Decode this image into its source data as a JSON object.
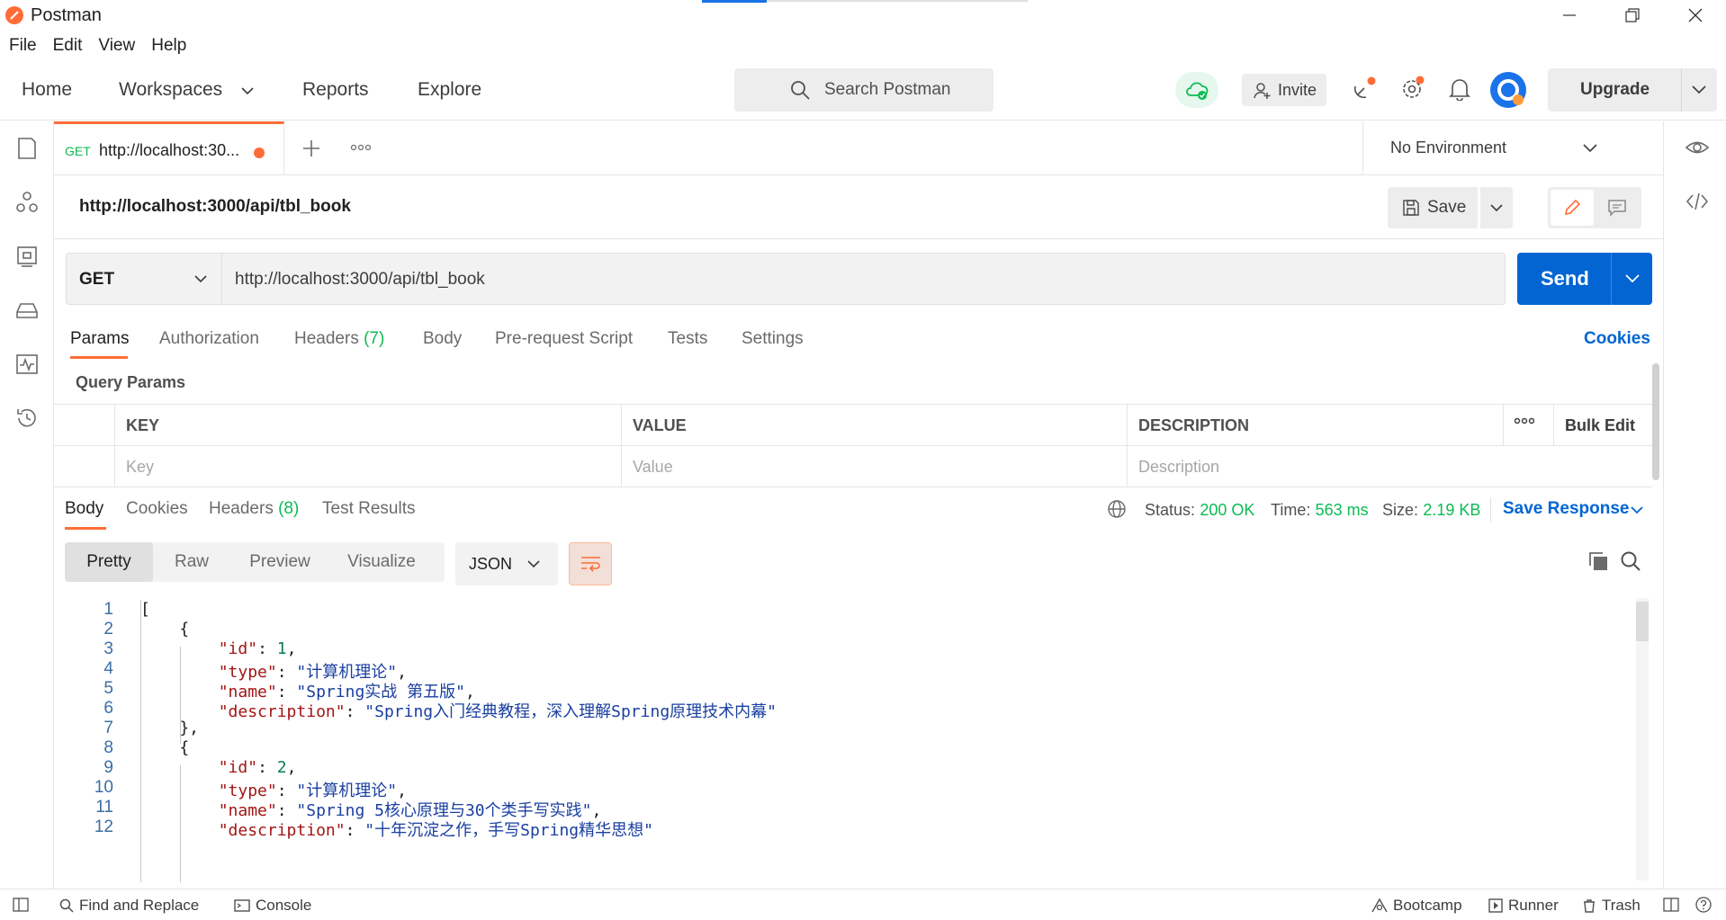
{
  "window": {
    "title": "Postman"
  },
  "menu": [
    "File",
    "Edit",
    "View",
    "Help"
  ],
  "header": {
    "nav": [
      "Home",
      "Workspaces",
      "Reports",
      "Explore"
    ],
    "search_placeholder": "Search Postman",
    "invite_label": "Invite",
    "upgrade_label": "Upgrade"
  },
  "tab": {
    "method": "GET",
    "title": "http://localhost:30...",
    "unsaved": true
  },
  "environment": {
    "selected": "No Environment"
  },
  "request": {
    "name": "http://localhost:3000/api/tbl_book",
    "save_label": "Save",
    "method": "GET",
    "url": "http://localhost:3000/api/tbl_book",
    "send_label": "Send",
    "tabs": [
      {
        "label": "Params"
      },
      {
        "label": "Authorization"
      },
      {
        "label": "Headers",
        "count": "(7)"
      },
      {
        "label": "Body"
      },
      {
        "label": "Pre-request Script"
      },
      {
        "label": "Tests"
      },
      {
        "label": "Settings"
      }
    ],
    "cookies_label": "Cookies",
    "query_params_title": "Query Params",
    "params_table": {
      "headers": [
        "KEY",
        "VALUE",
        "DESCRIPTION"
      ],
      "bulk_edit_label": "Bulk Edit",
      "placeholders": [
        "Key",
        "Value",
        "Description"
      ]
    }
  },
  "response": {
    "tabs": [
      {
        "label": "Body"
      },
      {
        "label": "Cookies"
      },
      {
        "label": "Headers",
        "count": "(8)"
      },
      {
        "label": "Test Results"
      }
    ],
    "status_key": "Status:",
    "status": "200 OK",
    "time_key": "Time:",
    "time": "563 ms",
    "size_key": "Size:",
    "size": "2.19 KB",
    "save_response_label": "Save Response",
    "views": [
      "Pretty",
      "Raw",
      "Preview",
      "Visualize"
    ],
    "format": "JSON",
    "code_lines": [
      {
        "n": "1",
        "text": "["
      },
      {
        "n": "2",
        "text": "    {"
      },
      {
        "n": "3",
        "key": "\"id\"",
        "num": "1"
      },
      {
        "n": "4",
        "key": "\"type\"",
        "str": "\"计算机理论\""
      },
      {
        "n": "5",
        "key": "\"name\"",
        "str": "\"Spring实战 第五版\""
      },
      {
        "n": "6",
        "key": "\"description\"",
        "str": "\"Spring入门经典教程，深入理解Spring原理技术内幕\"",
        "last": true
      },
      {
        "n": "7",
        "text": "    },"
      },
      {
        "n": "8",
        "text": "    {"
      },
      {
        "n": "9",
        "key": "\"id\"",
        "num": "2"
      },
      {
        "n": "10",
        "key": "\"type\"",
        "str": "\"计算机理论\""
      },
      {
        "n": "11",
        "key": "\"name\"",
        "str": "\"Spring 5核心原理与30个类手写实践\""
      },
      {
        "n": "12",
        "key": "\"description\"",
        "str": "\"十年沉淀之作，手写Spring精华思想\"",
        "last": true
      }
    ]
  },
  "statusbar": {
    "left": [
      "Find and Replace",
      "Console"
    ],
    "right": [
      "Bootcamp",
      "Runner",
      "Trash"
    ]
  },
  "colors": {
    "accent": "#ff6c37",
    "send": "#0265d2",
    "success": "#0cbb52"
  }
}
